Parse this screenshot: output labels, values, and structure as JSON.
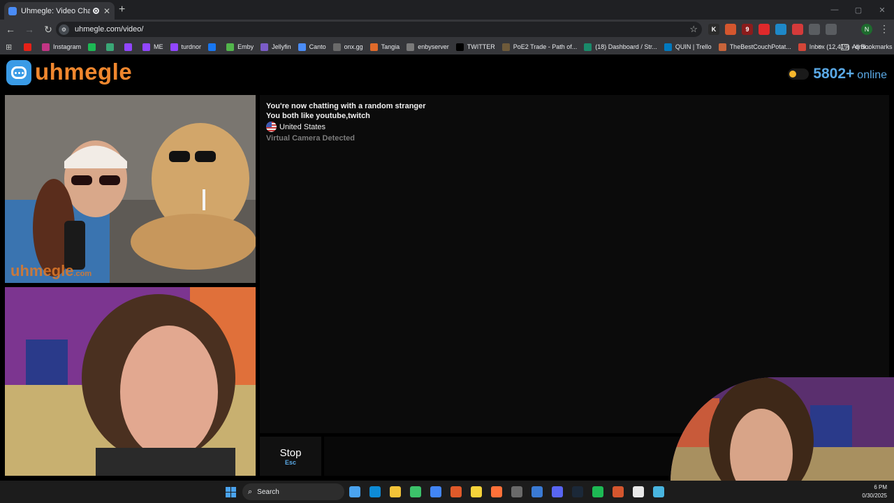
{
  "browser": {
    "tab_title": "Uhmegle: Video Chat | Rand",
    "new_tab": "+",
    "close_tab": "✕",
    "url": "uhmegle.com/video/",
    "window_controls": [
      "—",
      "▢",
      "✕"
    ],
    "extensions": [
      {
        "name": "K",
        "color": "#2b2b2b"
      },
      {
        "name": "",
        "color": "#d4562e"
      },
      {
        "name": "9",
        "color": "#8a1c1c"
      },
      {
        "name": "",
        "color": "#e0292b"
      },
      {
        "name": "",
        "color": "#1e88c8"
      },
      {
        "name": "",
        "color": "#d43a3a"
      },
      {
        "name": "",
        "color": "#5a5d61"
      },
      {
        "name": "",
        "color": "#5a5d61"
      }
    ],
    "profile_initial": "N",
    "bookmarks": [
      {
        "label": "",
        "color": "#e62117"
      },
      {
        "label": "Instagram",
        "color": "#c13584"
      },
      {
        "label": "",
        "color": "#1db954"
      },
      {
        "label": "",
        "color": "#3aa776"
      },
      {
        "label": "",
        "color": "#9146ff"
      },
      {
        "label": "ME",
        "color": "#9146ff"
      },
      {
        "label": "turdnor",
        "color": "#9146ff"
      },
      {
        "label": "",
        "color": "#1877f2"
      },
      {
        "label": "Emby",
        "color": "#52b54b"
      },
      {
        "label": "Jellyfin",
        "color": "#7b5cc7"
      },
      {
        "label": "Canto",
        "color": "#4a8cf7"
      },
      {
        "label": "onx.gg",
        "color": "#6a6a6a"
      },
      {
        "label": "Tangia",
        "color": "#e06a2a"
      },
      {
        "label": "enbyserver",
        "color": "#7a7a7a"
      },
      {
        "label": "TWITTER",
        "color": "#000000"
      },
      {
        "label": "PoE2 Trade - Path of...",
        "color": "#6e5a3a"
      },
      {
        "label": "(18) Dashboard / Str...",
        "color": "#1a8a6a"
      },
      {
        "label": "QUIN | Trello",
        "color": "#0079bf"
      },
      {
        "label": "TheBestCouchPotat...",
        "color": "#c8643a"
      },
      {
        "label": "Inbox (12,419) - qmi...",
        "color": "#d44638"
      }
    ],
    "bookmarks_more": "»",
    "all_bookmarks": "All Bookmarks"
  },
  "site": {
    "logo_text": "uhmegle",
    "online_count": "5802+",
    "online_label": "online"
  },
  "stranger_video": {
    "watermark": "uhmegle",
    "watermark_suffix": ".com"
  },
  "chat": {
    "messages": [
      "You're now chatting with a random stranger",
      "You both like youtube,twitch"
    ],
    "country": "United States",
    "notice": "Virtual Camera Detected"
  },
  "controls": {
    "stop_label": "Stop",
    "stop_shortcut": "Esc"
  },
  "taskbar": {
    "search_label": "Search",
    "icons": [
      "#4aa3ef",
      "#0e8bd6",
      "#f3c338",
      "#3cc36a",
      "#4285f4",
      "#e05a2a",
      "#f5d33a",
      "#ff7139",
      "#6a6a6a",
      "#3a7ad4",
      "#5865f2",
      "#1b2838",
      "#1db954",
      "#d4562e",
      "#e8e8e8",
      "#49b5e0"
    ],
    "time": "6 PM",
    "date": "0/30/2025"
  }
}
